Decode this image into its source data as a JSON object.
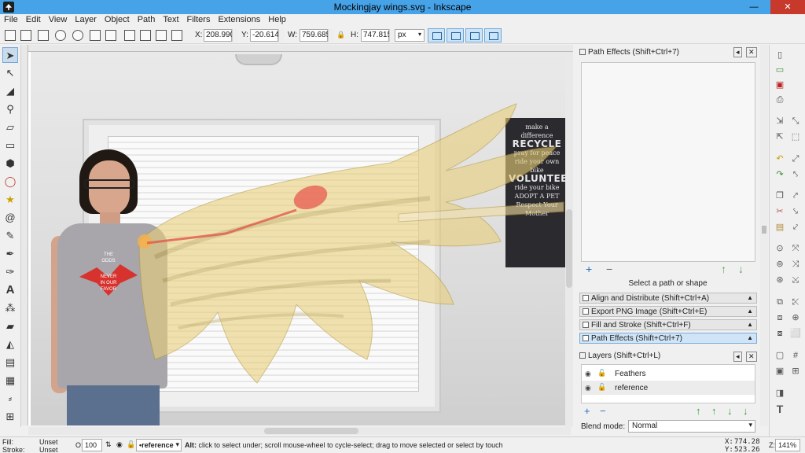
{
  "window": {
    "title": "Mockingjay wings.svg - Inkscape",
    "min_glyph": "—",
    "max_glyph": "▢",
    "close_glyph": "✕"
  },
  "menu": [
    "File",
    "Edit",
    "View",
    "Layer",
    "Object",
    "Path",
    "Text",
    "Filters",
    "Extensions",
    "Help"
  ],
  "tool_controls": {
    "x_label": "X:",
    "x_value": "208.990",
    "y_label": "Y:",
    "y_value": "-20.614",
    "w_label": "W:",
    "w_value": "759.685",
    "h_label": "H:",
    "h_value": "747.815",
    "unit": "px"
  },
  "canvas": {
    "sign_lines": [
      "make a difference",
      "RECYCLE",
      "pray for peace",
      "ride your own bike",
      "VOLUNTEER",
      "ride your bike",
      "ADOPT A PET",
      "Respect Your Mother"
    ],
    "shirt_lines": [
      "THE",
      "ODDS",
      "NEVER",
      "IN OUR",
      "FAVOR"
    ]
  },
  "dock": {
    "path_effects_title": "Path Effects  (Shift+Ctrl+7)",
    "add_glyph": "+",
    "remove_glyph": "−",
    "up_glyph": "↑",
    "down_glyph": "↓",
    "path_effects_status": "Select a path or shape",
    "tabs": [
      {
        "label": "Align and Distribute (Shift+Ctrl+A)"
      },
      {
        "label": "Export PNG Image (Shift+Ctrl+E)"
      },
      {
        "label": "Fill and Stroke (Shift+Ctrl+F)"
      },
      {
        "label": "Path Effects  (Shift+Ctrl+7)"
      }
    ],
    "layers_title": "Layers (Shift+Ctrl+L)",
    "layers": [
      {
        "name": "Feathers"
      },
      {
        "name": "reference"
      }
    ],
    "blend_label": "Blend mode:",
    "blend_value": "Normal"
  },
  "status": {
    "fill_label": "Fill:",
    "fill_value": "Unset",
    "stroke_label": "Stroke:",
    "stroke_value": "Unset",
    "opacity_label": "O:",
    "opacity_value": "100",
    "layer_value": "•reference",
    "message_bold": "Alt:",
    "message": " click to select under; scroll mouse-wheel to cycle-select; drag to move selected or select by touch",
    "x_label": "X:",
    "x_value": "774.28",
    "y_label": "Y:",
    "y_value": "523.26",
    "z_label": "Z:",
    "zoom_value": "141%"
  }
}
